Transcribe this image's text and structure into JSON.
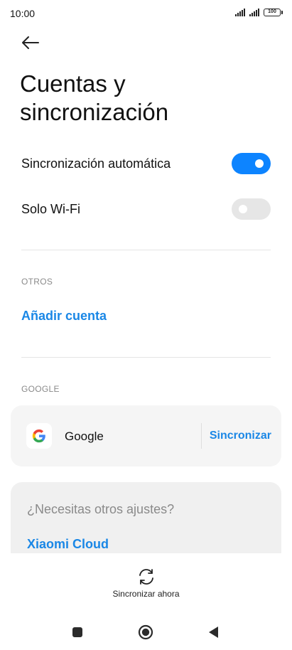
{
  "status_bar": {
    "time": "10:00",
    "battery": "100"
  },
  "header": {
    "back_icon": "arrow-left-icon",
    "title": "Cuentas y sincronización"
  },
  "toggles": [
    {
      "label": "Sincronización automática",
      "on": true
    },
    {
      "label": "Solo Wi-Fi",
      "on": false
    }
  ],
  "otros": {
    "header": "OTROS",
    "add_account": "Añadir cuenta"
  },
  "google_section": {
    "header": "GOOGLE",
    "account_name": "Google",
    "sync_label": "Sincronizar",
    "logo_icon": "google-logo-icon"
  },
  "more_settings": {
    "question": "¿Necesitas otros ajustes?",
    "link": "Xiaomi Cloud"
  },
  "bottom_action": {
    "label": "Sincronizar ahora",
    "icon": "sync-icon"
  },
  "nav": {
    "recents_icon": "square-icon",
    "home_icon": "circle-icon",
    "back_icon": "triangle-back-icon"
  },
  "colors": {
    "accent": "#0d84ff",
    "link": "#1a87e6",
    "switch_off": "#e6e6e6"
  }
}
